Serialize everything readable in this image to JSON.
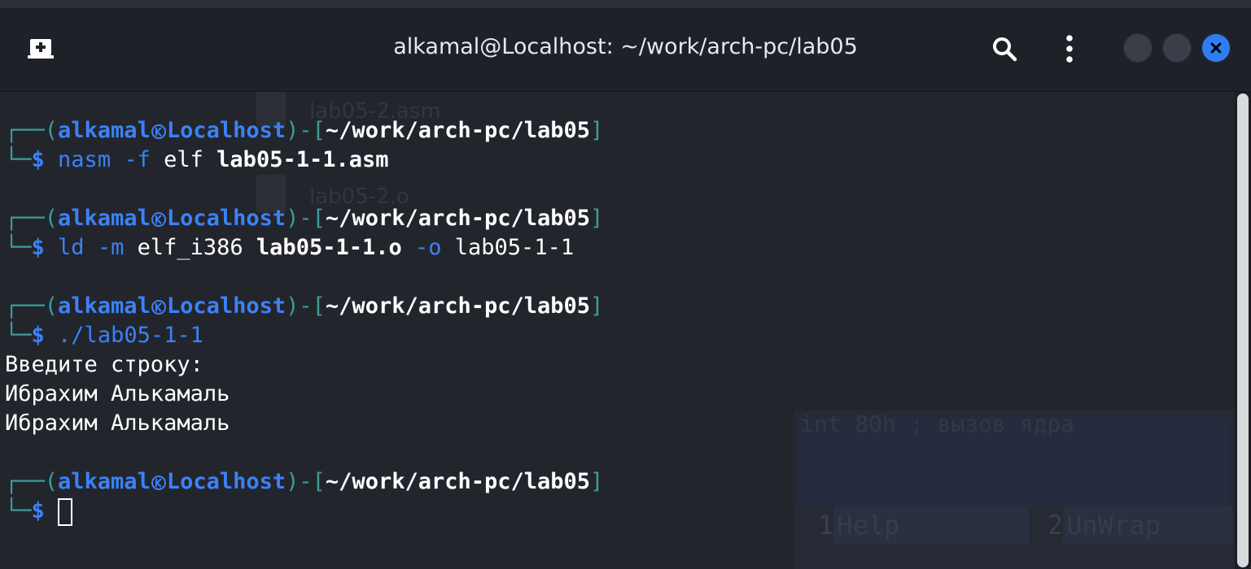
{
  "window": {
    "title": "alkamal@Localhost: ~/work/arch-pc/lab05"
  },
  "colors": {
    "prompt_frame": "#3a9e9a",
    "prompt_user_host": "#3b82f6",
    "command": "#3b82f6",
    "path": "#ffffff",
    "close_button": "#2f7df6",
    "background": "#23252d"
  },
  "icons": {
    "new_tab": "new-tab-icon",
    "search": "search-icon",
    "menu": "kebab-menu-icon",
    "close": "close-icon",
    "separator": "kali-k-icon"
  },
  "prompt": {
    "user": "alkamal",
    "host": "Localhost",
    "path": "~/work/arch-pc/lab05",
    "symbol": "$"
  },
  "commands": [
    {
      "cmd": "nasm",
      "flag": "-f",
      "flag_arg": "elf",
      "file": "lab05-1-1.asm"
    },
    {
      "cmd": "ld",
      "flag": "-m",
      "flag_arg": "elf_i386",
      "file": "lab05-1-1.o",
      "out_flag": "-o",
      "out_file": "lab05-1-1"
    },
    {
      "cmd": "./lab05-1-1"
    }
  ],
  "output": [
    "Введите строку:",
    "Ибрахим Алькамаль",
    "Ибрахим Алькамаль"
  ],
  "background_ghosts": {
    "file1": "lab05-2.asm",
    "file2": "lab05-2.o",
    "editor_line": "int 80h ; вызов ядра",
    "fkeys": [
      {
        "num": "1",
        "label": "Help"
      },
      {
        "num": "2",
        "label": "UnWrap"
      }
    ]
  }
}
